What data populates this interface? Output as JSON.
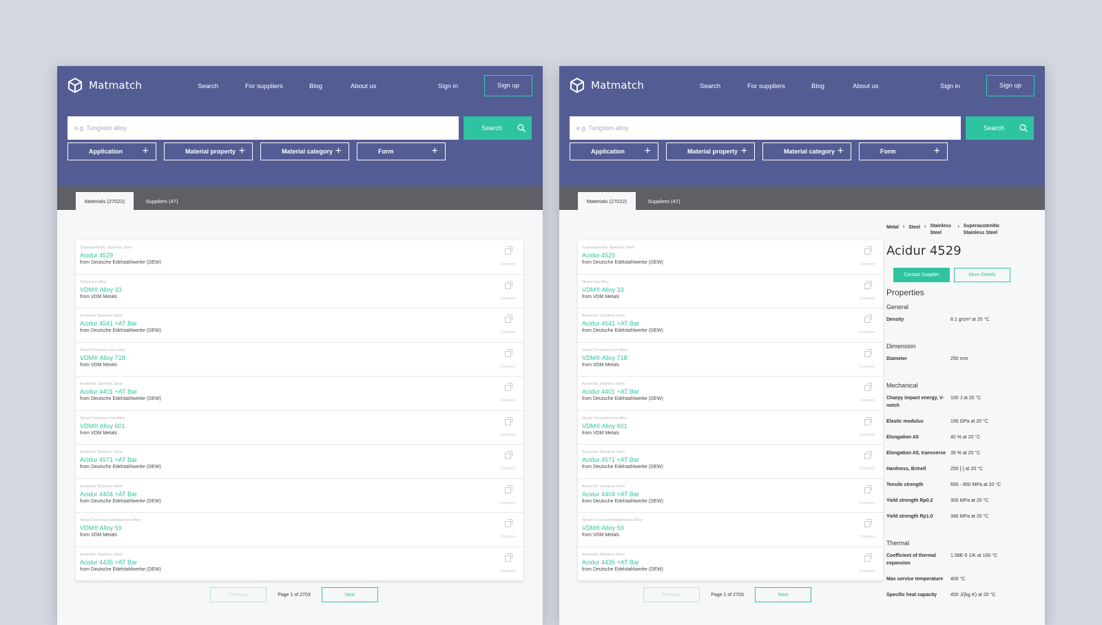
{
  "header": {
    "logo": "Matmatch",
    "nav": [
      "Search",
      "For suppliers",
      "Blog",
      "About us"
    ],
    "sign_in": "Sign in",
    "sign_up": "Sign up"
  },
  "search": {
    "placeholder": "e.g. Tungsten alloy",
    "button": "Search"
  },
  "filters": [
    "Application",
    "Material property",
    "Material category",
    "Form"
  ],
  "tabs": [
    "Materials (27022)",
    "Suppliers (47)"
  ],
  "materials": [
    {
      "category": "Superaustenitic Stainless Steel",
      "name": "Acidur 4529",
      "supplier": "from Deutsche Edelstahlwerke (DEW)"
    },
    {
      "category": "Nickel Iron Alloy",
      "name": "VDM® Alloy 33",
      "supplier": "from VDM Metals"
    },
    {
      "category": "Austenitic Stainless Steel",
      "name": "Acidur 4541 +AT Bar",
      "supplier": "from Deutsche Edelstahlwerke (DEW)"
    },
    {
      "category": "Nickel Chromium Iron Alloy",
      "name": "VDM® Alloy 718",
      "supplier": "from VDM Metals"
    },
    {
      "category": "Austenitic Stainless Steel",
      "name": "Acidur 4401 +AT Bar",
      "supplier": "from Deutsche Edelstahlwerke (DEW)"
    },
    {
      "category": "Nickel Chromium Iron Alloy",
      "name": "VDM® Alloy 601",
      "supplier": "from VDM Metals"
    },
    {
      "category": "Austenitic Stainless Steel",
      "name": "Acidur 4571 +AT Bar",
      "supplier": "from Deutsche Edelstahlwerke (DEW)"
    },
    {
      "category": "Austenitic Stainless Steel",
      "name": "Acidur 4404 +AT Bar",
      "supplier": "from Deutsche Edelstahlwerke (DEW)"
    },
    {
      "category": "Nickel Chromium Molybdenum Alloy",
      "name": "VDM® Alloy 59",
      "supplier": "from VDM Metals"
    },
    {
      "category": "Austenitic Stainless Steel",
      "name": "Acidur 4435 +AT Bar",
      "supplier": "from Deutsche Edelstahlwerke (DEW)"
    }
  ],
  "compare_label": "Compare",
  "pagination": {
    "previous": "Previous",
    "info": "Page 1 of 2703",
    "next": "Next"
  },
  "detail": {
    "breadcrumb": [
      "Metal",
      "Steel",
      "Stainless Steel",
      "Superaustenitic Stainless Steel"
    ],
    "title": "Acidur 4529",
    "contact": "Contact Supplier",
    "more": "More Details",
    "properties_heading": "Properties",
    "sections": [
      {
        "title": "General",
        "rows": [
          {
            "name": "Density",
            "value": "8.1 g/cm³ at 20 °C"
          }
        ]
      },
      {
        "title": "Dimension",
        "rows": [
          {
            "name": "Diameter",
            "value": "250 mm"
          }
        ]
      },
      {
        "title": "Mechanical",
        "rows": [
          {
            "name": "Charpy impact energy, V-notch",
            "value": "100 J at 20 °C"
          },
          {
            "name": "Elastic modulus",
            "value": "195 GPa at 20 °C"
          },
          {
            "name": "Elongation A5",
            "value": "40 % at 20 °C"
          },
          {
            "name": "Elongation A5, transverse",
            "value": "35 % at 20 °C"
          },
          {
            "name": "Hardness, Brinell",
            "value": "250 [-] at 20 °C"
          },
          {
            "name": "Tensile strength",
            "value": "650 - 850 MPa at 20 °C"
          },
          {
            "name": "Yield strength Rp0.2",
            "value": "300 MPa at 20 °C"
          },
          {
            "name": "Yield strength Rp1.0",
            "value": "340 MPa at 20 °C"
          }
        ]
      },
      {
        "title": "Thermal",
        "rows": [
          {
            "name": "Coefficient of thermal expansion",
            "value": "1.58E-5 1/K at 100 °C"
          },
          {
            "name": "Max service temperature",
            "value": "400 °C"
          },
          {
            "name": "Specific heat capacity",
            "value": "450 J/(kg·K) at 20 °C"
          }
        ]
      }
    ]
  },
  "colors": {
    "header": "#535c93",
    "accent": "#2ec4a1",
    "tabbar": "#5e6066",
    "backdrop": "#d4d7e0"
  }
}
